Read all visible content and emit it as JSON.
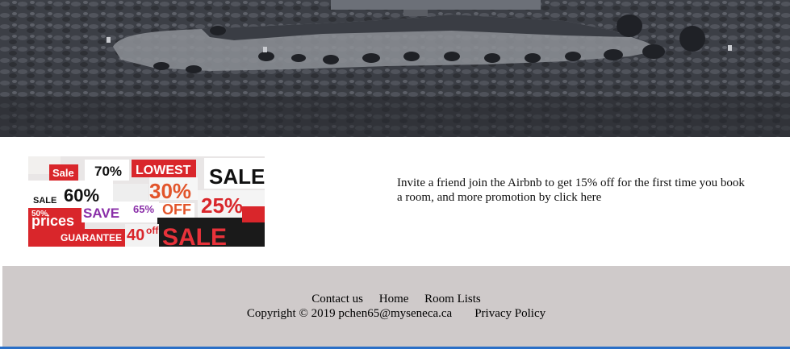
{
  "hero": {
    "image_icon": "lava-field-path-photo"
  },
  "promo": {
    "image_icon": "sale-stickers-collage",
    "sticker_words": [
      "Sale",
      "70%",
      "LOWEST",
      "SALE",
      "60%",
      "SALE",
      "30%",
      "OFF",
      "25%",
      "SAVE",
      "65%",
      "prices",
      "GUARANTEE",
      "40",
      "off",
      "SALE",
      "50%"
    ],
    "text": "Invite a friend join the Airbnb to get 15% off for the first time you book a room, and more promotion by click here"
  },
  "footer": {
    "nav": [
      "Contact us",
      "Home",
      "Room Lists"
    ],
    "copyright": "Copyright © 2019 pchen65@myseneca.ca",
    "privacy": "Privacy Policy"
  },
  "colors": {
    "footer_bg": "#cfcaca",
    "hero_dark": "#3a3d44",
    "taskbar_strip": "#2a6fc7"
  }
}
